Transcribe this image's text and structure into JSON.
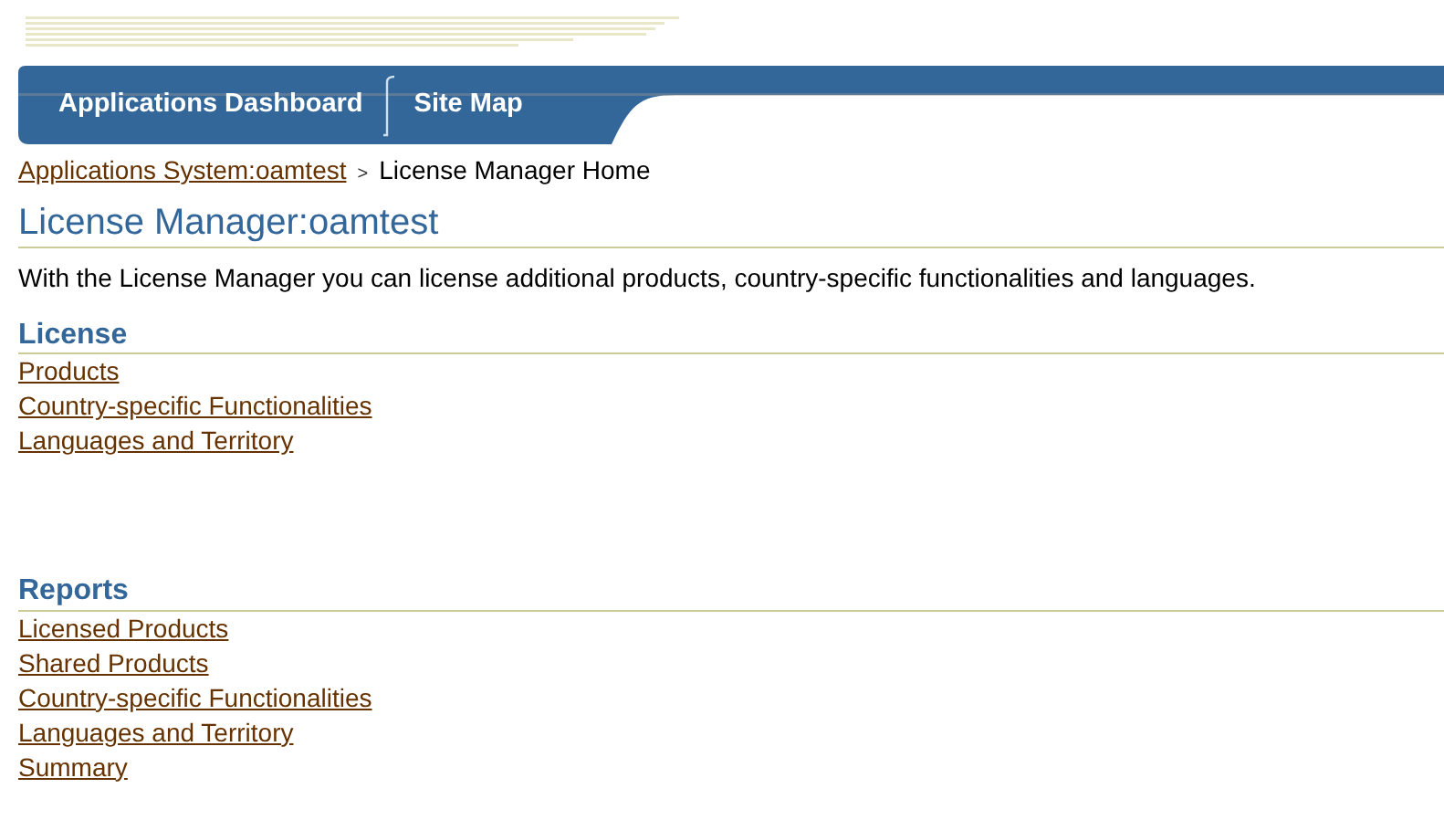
{
  "tabs": [
    {
      "label": "Applications Dashboard"
    },
    {
      "label": "Site Map"
    }
  ],
  "breadcrumb": {
    "link": "Applications System:oamtest",
    "separator": ">",
    "current": "License Manager Home"
  },
  "title": "License Manager:oamtest",
  "description": "With the License Manager you can license additional products, country-specific functionalities and languages.",
  "sections": [
    {
      "heading": "License",
      "links": [
        "Products",
        "Country-specific Functionalities",
        "Languages and Territory"
      ]
    },
    {
      "heading": "Reports",
      "links": [
        "Licensed Products",
        "Shared Products",
        "Country-specific Functionalities",
        "Languages and Territory",
        "Summary"
      ]
    }
  ]
}
